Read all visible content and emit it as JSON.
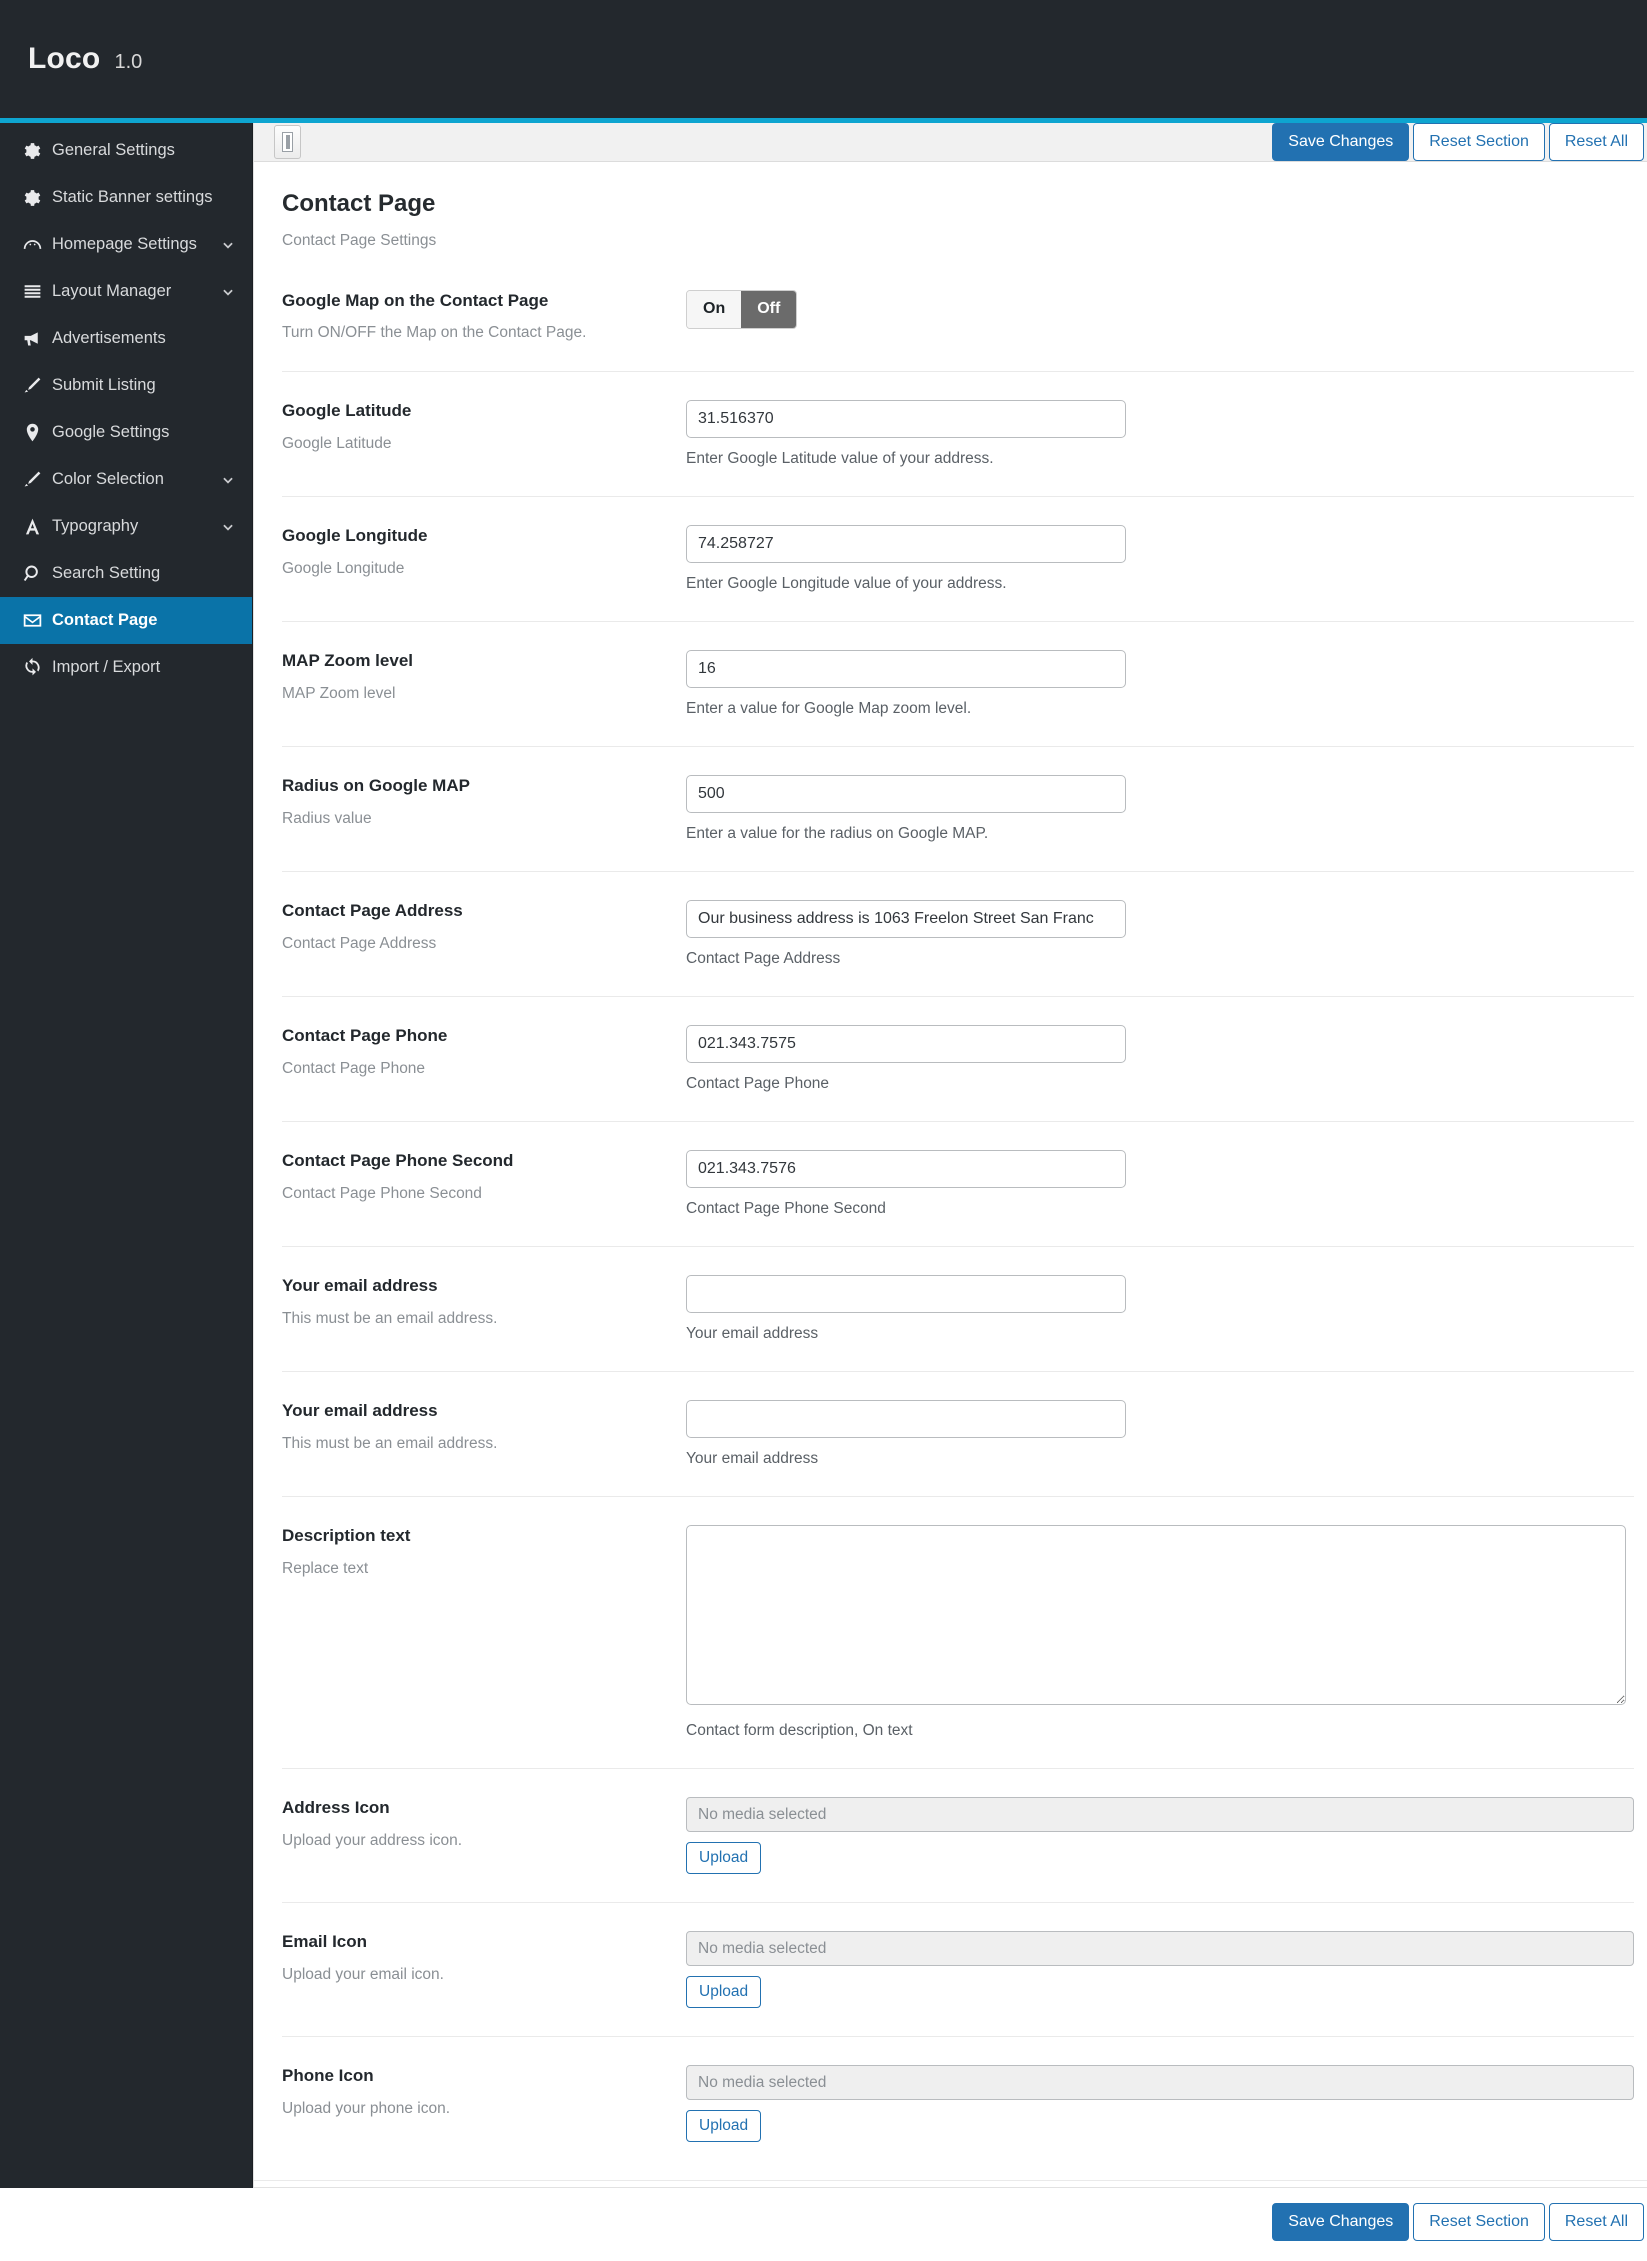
{
  "app": {
    "name": "Loco",
    "version": "1.0"
  },
  "sidebar": {
    "items": [
      {
        "label": "General Settings",
        "icon": "gear-icon",
        "expandable": false,
        "active": false
      },
      {
        "label": "Static Banner settings",
        "icon": "gear-icon",
        "expandable": false,
        "active": false
      },
      {
        "label": "Homepage Settings",
        "icon": "dashboard-icon",
        "expandable": true,
        "active": false
      },
      {
        "label": "Layout Manager",
        "icon": "menu-lines-icon",
        "expandable": true,
        "active": false
      },
      {
        "label": "Advertisements",
        "icon": "megaphone-icon",
        "expandable": false,
        "active": false
      },
      {
        "label": "Submit Listing",
        "icon": "brush-icon",
        "expandable": false,
        "active": false
      },
      {
        "label": "Google Settings",
        "icon": "map-pin-icon",
        "expandable": false,
        "active": false
      },
      {
        "label": "Color Selection",
        "icon": "brush-icon",
        "expandable": true,
        "active": false
      },
      {
        "label": "Typography",
        "icon": "letter-a-icon",
        "expandable": true,
        "active": false
      },
      {
        "label": "Search Setting",
        "icon": "search-icon",
        "expandable": false,
        "active": false
      },
      {
        "label": "Contact Page",
        "icon": "envelope-icon",
        "expandable": false,
        "active": true
      },
      {
        "label": "Import / Export",
        "icon": "refresh-icon",
        "expandable": false,
        "active": false
      }
    ]
  },
  "toolbar": {
    "save_label": "Save Changes",
    "reset_section_label": "Reset Section",
    "reset_all_label": "Reset All",
    "panel_toggle_name": "expand-panel-icon"
  },
  "footer": {
    "save_label": "Save Changes",
    "reset_section_label": "Reset Section",
    "reset_all_label": "Reset All"
  },
  "page": {
    "title": "Contact Page",
    "subtitle": "Contact Page Settings"
  },
  "fields": {
    "map_toggle": {
      "title": "Google Map on the Contact Page",
      "desc": "Turn ON/OFF the Map on the Contact Page.",
      "on_label": "On",
      "off_label": "Off",
      "selected": "Off"
    },
    "latitude": {
      "title": "Google Latitude",
      "desc": "Google Latitude",
      "value": "31.516370",
      "help": "Enter Google Latitude value of your address."
    },
    "longitude": {
      "title": "Google Longitude",
      "desc": "Google Longitude",
      "value": "74.258727",
      "help": "Enter Google Longitude value of your address."
    },
    "zoom_level": {
      "title": "MAP Zoom level",
      "desc": "MAP Zoom level",
      "value": "16",
      "help": "Enter a value for Google Map zoom level."
    },
    "radius": {
      "title": "Radius on Google MAP",
      "desc": "Radius value",
      "value": "500",
      "help": "Enter a value for the radius on Google MAP."
    },
    "address": {
      "title": "Contact Page Address",
      "desc": "Contact Page Address",
      "value": "Our business address is 1063 Freelon Street San Franc",
      "help": "Contact Page Address"
    },
    "phone": {
      "title": "Contact Page Phone",
      "desc": "Contact Page Phone",
      "value": "021.343.7575",
      "help": "Contact Page Phone"
    },
    "phone_second": {
      "title": "Contact Page Phone Second",
      "desc": "Contact Page Phone Second",
      "value": "021.343.7576",
      "help": "Contact Page Phone Second"
    },
    "email_1": {
      "title": "Your email address",
      "desc": "This must be an email address.",
      "value": "",
      "help": "Your email address"
    },
    "email_2": {
      "title": "Your email address",
      "desc": "This must be an email address.",
      "value": "",
      "help": "Your email address"
    },
    "description_text": {
      "title": "Description text",
      "desc": "Replace text",
      "value": "",
      "help": "Contact form description, On text"
    },
    "address_icon": {
      "title": "Address Icon",
      "desc": "Upload your address icon.",
      "media_status": "No media selected",
      "upload_label": "Upload"
    },
    "email_icon": {
      "title": "Email Icon",
      "desc": "Upload your email icon.",
      "media_status": "No media selected",
      "upload_label": "Upload"
    },
    "phone_icon": {
      "title": "Phone Icon",
      "desc": "Upload your phone icon.",
      "media_status": "No media selected",
      "upload_label": "Upload"
    }
  },
  "colors": {
    "topbar_bg": "#23282d",
    "accent": "#0ea5d0",
    "active_nav": "#0a73a8",
    "primary_button": "#2271b1",
    "toggle_off": "#6b6b6b"
  }
}
